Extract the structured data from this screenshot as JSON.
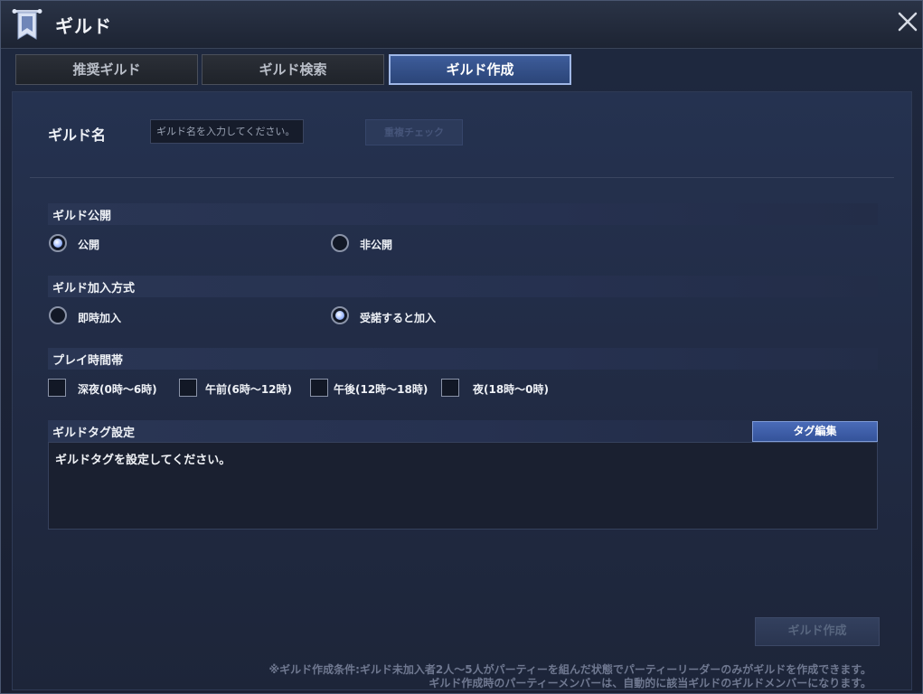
{
  "window": {
    "title": "ギルド"
  },
  "tabs": [
    {
      "label": "推奨ギルド"
    },
    {
      "label": "ギルド検索"
    },
    {
      "label": "ギルド作成"
    }
  ],
  "form": {
    "name_label": "ギルド名",
    "name_placeholder": "ギルド名を入力してください。",
    "name_value": "",
    "dup_check_label": "重複チェック",
    "visibility": {
      "label": "ギルド公開",
      "options": [
        "公開",
        "非公開"
      ],
      "selected": "公開"
    },
    "join_method": {
      "label": "ギルド加入方式",
      "options": [
        "即時加入",
        "受諾すると加入"
      ],
      "selected": "受諾すると加入"
    },
    "play_time": {
      "label": "プレイ時間帯",
      "options": [
        "深夜(0時～6時)",
        "午前(6時～12時)",
        "午後(12時～18時)",
        "夜(18時～0時)"
      ],
      "checked": []
    },
    "tags": {
      "label": "ギルドタグ設定",
      "edit_label": "タグ編集",
      "placeholder_text": "ギルドタグを設定してください。"
    },
    "create_label": "ギルド作成"
  },
  "notes": [
    "※ギルド作成条件:ギルド未加入者2人～5人がパーティーを組んだ状態でパーティーリーダーのみがギルドを作成できます。",
    "ギルド作成時のパーティーメンバーは、自動的に該当ギルドのギルドメンバーになります。"
  ],
  "colors": {
    "accent": "#3d5c9a",
    "panel": "#253250",
    "text": "#eef1f6"
  },
  "icons": {
    "title": "guild-banner-icon",
    "close": "close-icon"
  }
}
